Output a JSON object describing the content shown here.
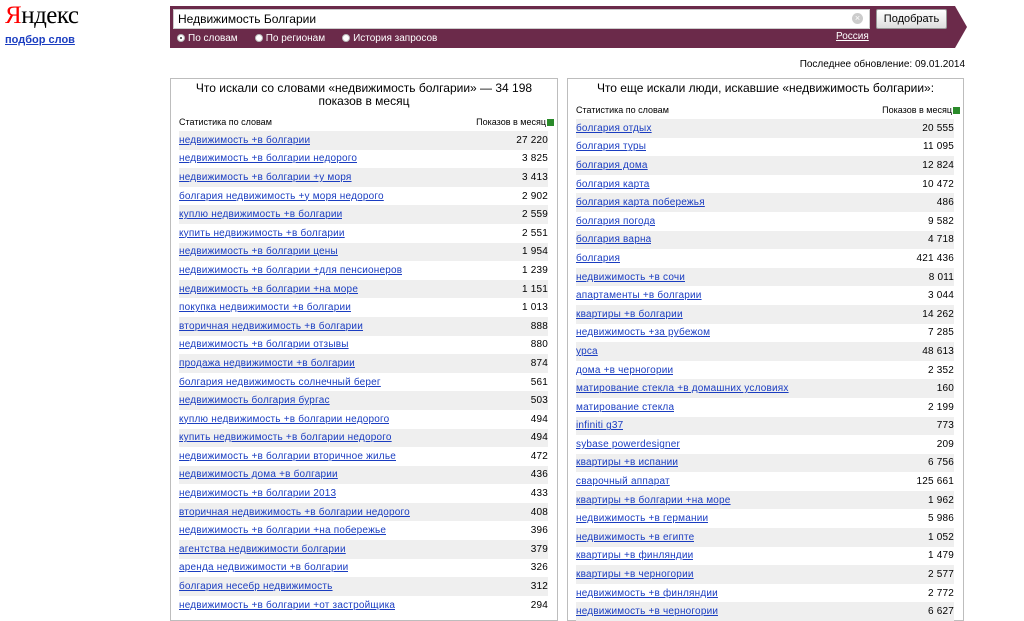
{
  "logo": {
    "first": "Я",
    "rest": "ндекс"
  },
  "sublink": "подбор слов",
  "search": {
    "value": "Недвижимость Болгарии",
    "button": "Подобрать",
    "region": "Россия"
  },
  "modes": [
    {
      "label": "По словам",
      "selected": true
    },
    {
      "label": "По регионам",
      "selected": false
    },
    {
      "label": "История запросов",
      "selected": false
    }
  ],
  "last_update": "Последнее обновление: 09.01.2014",
  "left": {
    "title": "Что искали со словами «недвижимость болгарии» — 34 198 показов в месяц",
    "col_words": "Статистика по словам",
    "col_count": "Показов в месяц",
    "rows": [
      {
        "kw": "недвижимость +в болгарии",
        "n": "27 220"
      },
      {
        "kw": "недвижимость +в болгарии недорого",
        "n": "3 825"
      },
      {
        "kw": "недвижимость +в болгарии +у моря",
        "n": "3 413"
      },
      {
        "kw": "болгария недвижимость +у моря недорого",
        "n": "2 902"
      },
      {
        "kw": "куплю недвижимость +в болгарии",
        "n": "2 559"
      },
      {
        "kw": "купить недвижимость +в болгарии",
        "n": "2 551"
      },
      {
        "kw": "недвижимость +в болгарии цены",
        "n": "1 954"
      },
      {
        "kw": "недвижимость +в болгарии +для пенсионеров",
        "n": "1 239"
      },
      {
        "kw": "недвижимость +в болгарии +на море",
        "n": "1 151"
      },
      {
        "kw": "покупка недвижимости +в болгарии",
        "n": "1 013"
      },
      {
        "kw": "вторичная недвижимость +в болгарии",
        "n": "888"
      },
      {
        "kw": "недвижимость +в болгарии отзывы",
        "n": "880"
      },
      {
        "kw": "продажа недвижимости +в болгарии",
        "n": "874"
      },
      {
        "kw": "болгария недвижимость солнечный берег",
        "n": "561"
      },
      {
        "kw": "недвижимость болгария бургас",
        "n": "503"
      },
      {
        "kw": "куплю недвижимость +в болгарии недорого",
        "n": "494"
      },
      {
        "kw": "купить недвижимость +в болгарии недорого",
        "n": "494"
      },
      {
        "kw": "недвижимость +в болгарии вторичное жилье",
        "n": "472"
      },
      {
        "kw": "недвижимость дома +в болгарии",
        "n": "436"
      },
      {
        "kw": "недвижимость +в болгарии 2013",
        "n": "433"
      },
      {
        "kw": "вторичная недвижимость +в болгарии недорого",
        "n": "408"
      },
      {
        "kw": "недвижимость +в болгарии +на побережье",
        "n": "396"
      },
      {
        "kw": "агентства недвижимости болгарии",
        "n": "379"
      },
      {
        "kw": "аренда недвижимости +в болгарии",
        "n": "326"
      },
      {
        "kw": "болгария несебр недвижимость",
        "n": "312"
      },
      {
        "kw": "недвижимость +в болгарии +от застройщика",
        "n": "294"
      }
    ]
  },
  "right": {
    "title": "Что еще искали люди, искавшие «недвижимость болгарии»:",
    "col_words": "Статистика по словам",
    "col_count": "Показов в месяц",
    "rows": [
      {
        "kw": "болгария отдых",
        "n": "20 555"
      },
      {
        "kw": "болгария туры",
        "n": "11 095"
      },
      {
        "kw": "болгария дома",
        "n": "12 824"
      },
      {
        "kw": "болгария карта",
        "n": "10 472"
      },
      {
        "kw": "болгария карта побережья",
        "n": "486"
      },
      {
        "kw": "болгария погода",
        "n": "9 582"
      },
      {
        "kw": "болгария варна",
        "n": "4 718"
      },
      {
        "kw": "болгария",
        "n": "421 436"
      },
      {
        "kw": "недвижимость +в сочи",
        "n": "8 011"
      },
      {
        "kw": "апартаменты +в болгарии",
        "n": "3 044"
      },
      {
        "kw": "квартиры +в болгарии",
        "n": "14 262"
      },
      {
        "kw": "недвижимость +за рубежом",
        "n": "7 285"
      },
      {
        "kw": "урса",
        "n": "48 613"
      },
      {
        "kw": "дома +в черногории",
        "n": "2 352"
      },
      {
        "kw": "матирование стекла +в домашних условиях",
        "n": "160"
      },
      {
        "kw": "матирование стекла",
        "n": "2 199"
      },
      {
        "kw": "infiniti g37",
        "n": "773"
      },
      {
        "kw": "sybase powerdesigner",
        "n": "209"
      },
      {
        "kw": "квартиры +в испании",
        "n": "6 756"
      },
      {
        "kw": "сварочный аппарат",
        "n": "125 661"
      },
      {
        "kw": "квартиры +в болгарии +на море",
        "n": "1 962"
      },
      {
        "kw": "недвижимость +в германии",
        "n": "5 986"
      },
      {
        "kw": "недвижимость +в египте",
        "n": "1 052"
      },
      {
        "kw": "квартиры +в финляндии",
        "n": "1 479"
      },
      {
        "kw": "квартиры +в черногории",
        "n": "2 577"
      },
      {
        "kw": "недвижимость +в финляндии",
        "n": "2 772"
      },
      {
        "kw": "недвижимость +в черногории",
        "n": "6 627"
      }
    ]
  }
}
